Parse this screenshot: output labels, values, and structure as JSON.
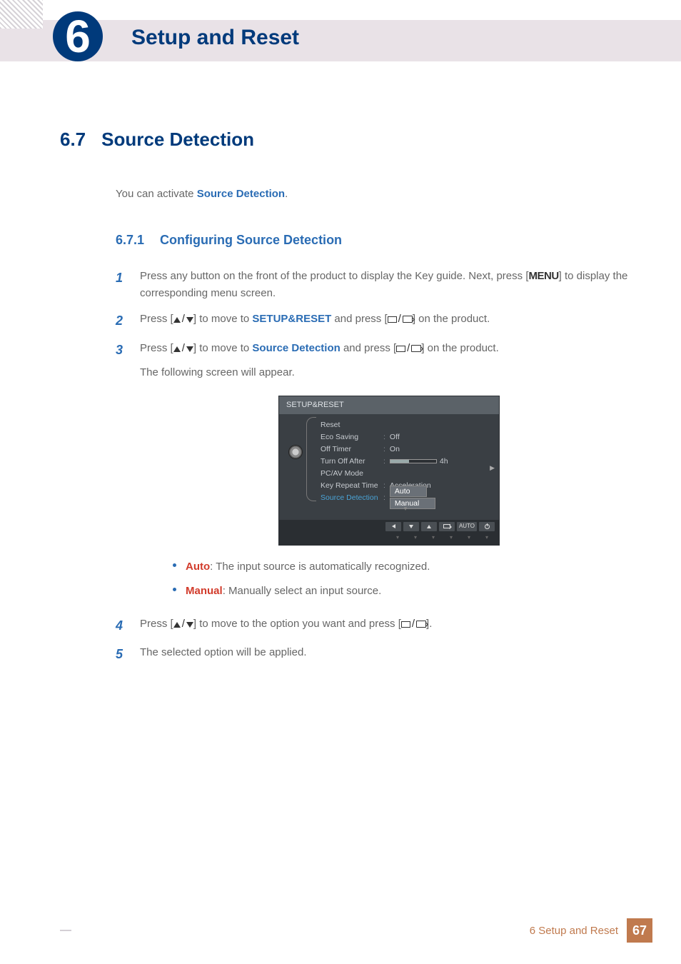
{
  "chapter": {
    "number": "6",
    "title": "Setup and Reset"
  },
  "section": {
    "number": "6.7",
    "title": "Source Detection"
  },
  "intro": {
    "prefix": "You can activate ",
    "keyword": "Source Detection",
    "suffix": "."
  },
  "subsection": {
    "number": "6.7.1",
    "title": "Configuring Source Detection"
  },
  "steps": {
    "s1": {
      "n": "1",
      "a": "Press any button on the front of the product to display the Key guide. Next, press [",
      "menu": "MENU",
      "b": "] to display the corresponding menu screen."
    },
    "s2": {
      "n": "2",
      "a": "Press [",
      "b": "] to move to ",
      "kw": "SETUP&RESET",
      "c": " and press [",
      "d": "] on the product."
    },
    "s3": {
      "n": "3",
      "a": "Press [",
      "b": "] to move to ",
      "kw": "Source Detection",
      "c": " and press [",
      "d": "] on the product.",
      "followup": "The following screen will appear."
    },
    "s4": {
      "n": "4",
      "a": "Press [",
      "b": "] to move to the option you want and press [",
      "c": "]."
    },
    "s5": {
      "n": "5",
      "text": "The selected option will be applied."
    }
  },
  "osd": {
    "title": "SETUP&RESET",
    "rows": {
      "reset": {
        "label": "Reset"
      },
      "eco": {
        "label": "Eco Saving",
        "val": "Off"
      },
      "offtimer": {
        "label": "Off Timer",
        "val": "On"
      },
      "turnoff": {
        "label": "Turn Off After",
        "val": "4h"
      },
      "pcav": {
        "label": "PC/AV Mode"
      },
      "keyrepeat": {
        "label": "Key Repeat Time",
        "val": "Acceleration"
      },
      "source": {
        "label": "Source Detection",
        "opt1": "Auto",
        "opt2": "Manual"
      }
    },
    "buttons": {
      "auto": "AUTO"
    }
  },
  "bullets": {
    "auto": {
      "hl": "Auto",
      "text": ": The input source is automatically recognized."
    },
    "manual": {
      "hl": "Manual",
      "text": ": Manually select an input source."
    }
  },
  "footer": {
    "text": "6 Setup and Reset",
    "page": "67"
  }
}
